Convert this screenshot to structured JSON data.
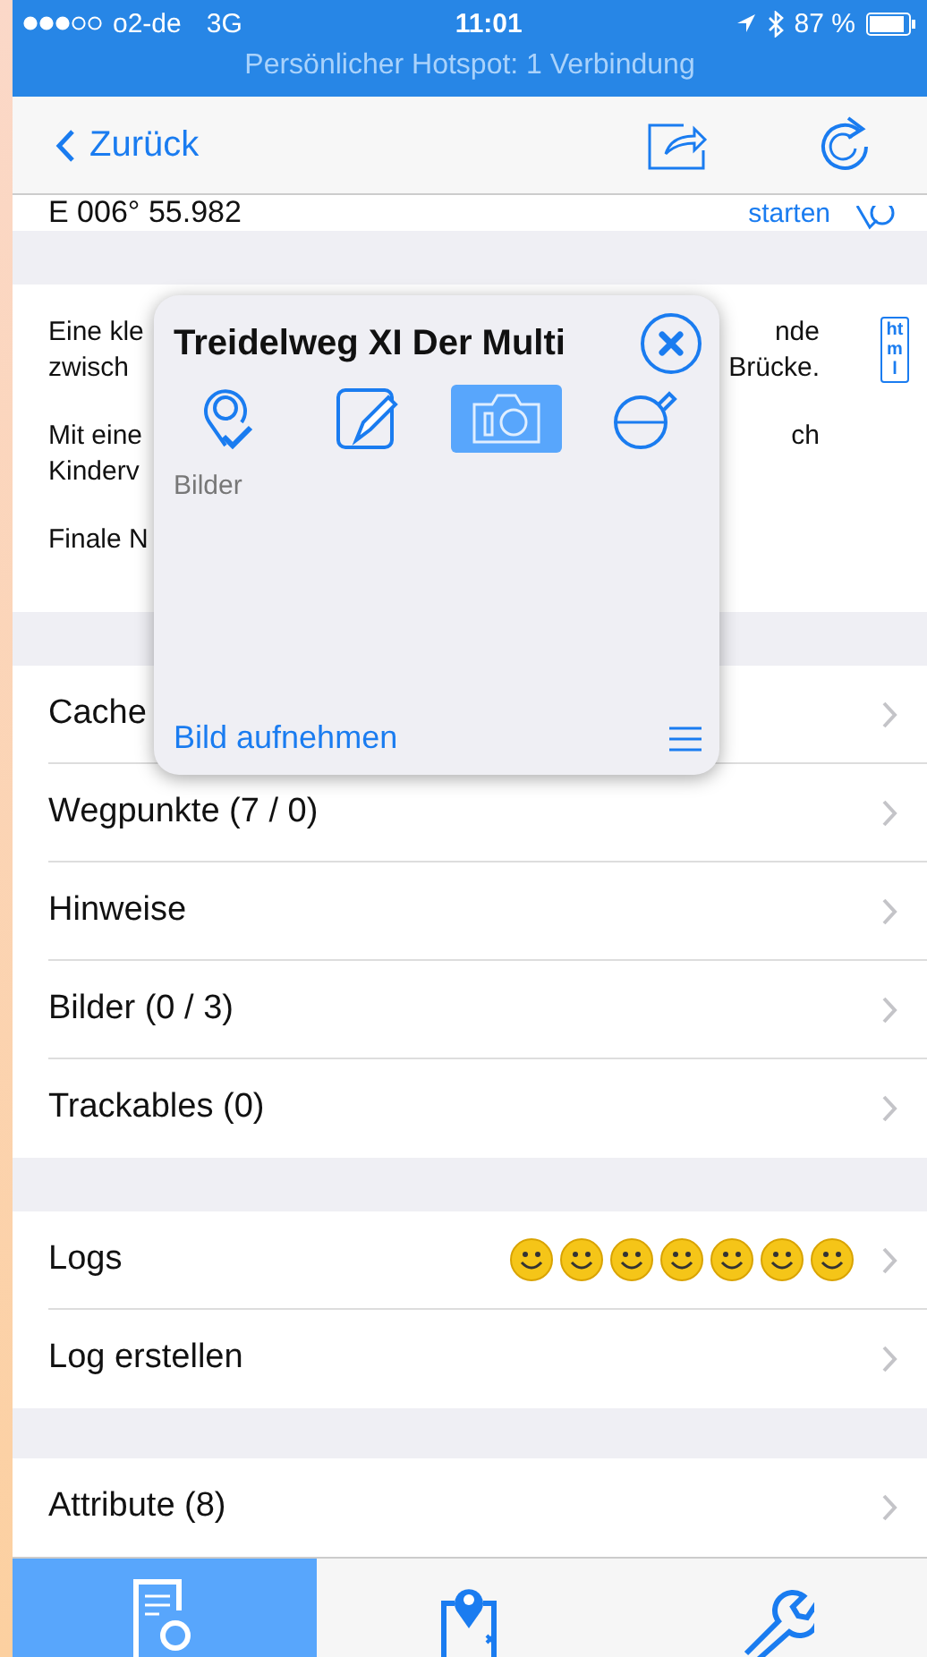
{
  "status_bar": {
    "carrier": "o2-de",
    "network": "3G",
    "time": "11:01",
    "battery": "87 %",
    "hotspot": "Persönlicher Hotspot: 1 Verbindung"
  },
  "nav_bar": {
    "back": "Zurück"
  },
  "coordinates": {
    "text": "E 006° 55.982",
    "action": "starten"
  },
  "description": {
    "paragraphs": [
      [
        {
          "left": "Eine kle",
          "right": "nde"
        },
        {
          "left": "zwisch",
          "right": "Brücke."
        }
      ],
      [
        {
          "left": "Mit eine",
          "right": "ch"
        },
        {
          "left": "Kinderv"
        }
      ],
      [
        {
          "left": "Finale N"
        }
      ]
    ],
    "badge": "html"
  },
  "sections": [
    [
      {
        "label": "Cache"
      },
      {
        "label": "Wegpunkte (7 / 0)"
      },
      {
        "label": "Hinweise"
      },
      {
        "label": "Bilder (0 / 3)"
      },
      {
        "label": "Trackables (0)"
      }
    ],
    [
      {
        "label": "Logs",
        "kind": "smileys"
      },
      {
        "label": "Log erstellen"
      }
    ],
    [
      {
        "label": "Attribute (8)"
      }
    ]
  ],
  "popup": {
    "title": "Treidelweg XI Der Multi",
    "icons": [
      {
        "kind": "pin-check",
        "selected": false
      },
      {
        "kind": "notes",
        "selected": false
      },
      {
        "kind": "camera",
        "selected": true
      },
      {
        "kind": "flask",
        "selected": false
      }
    ],
    "caption": "Bilder",
    "action": "Bild aufnehmen"
  },
  "tabs": [
    {
      "kind": "details",
      "selected": true
    },
    {
      "kind": "map",
      "selected": false
    },
    {
      "kind": "tools",
      "selected": false
    }
  ]
}
